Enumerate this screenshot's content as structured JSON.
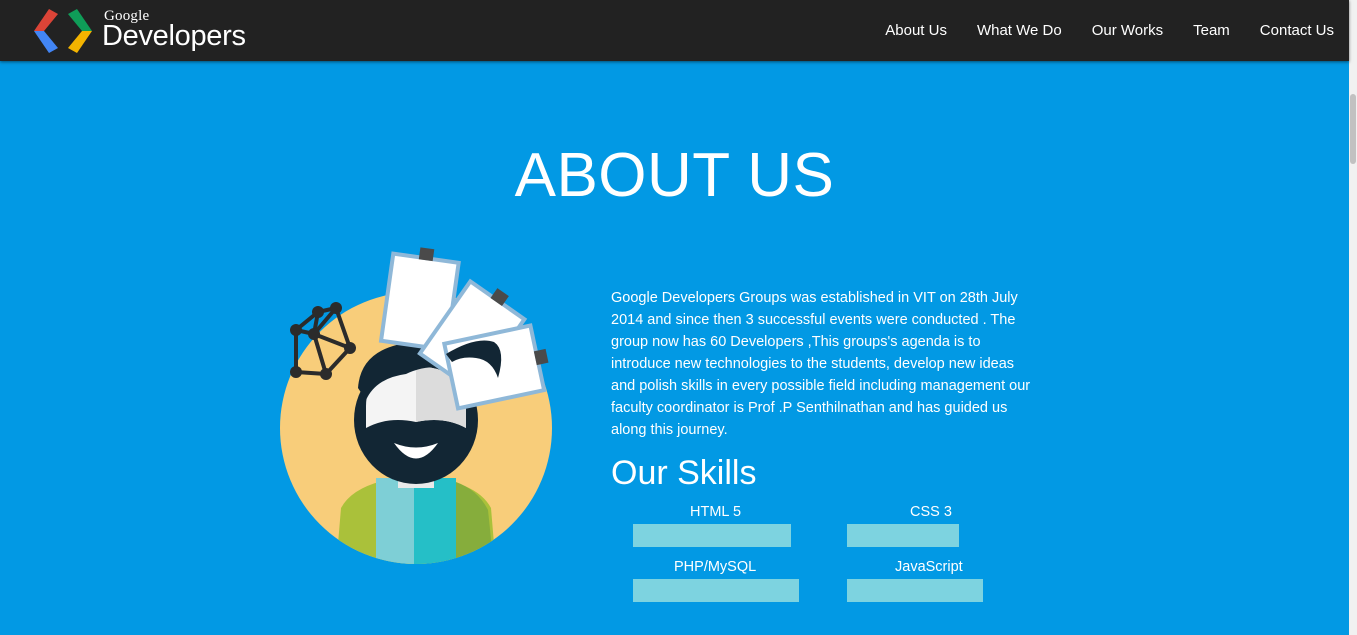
{
  "header": {
    "brand_small": "Google",
    "brand_large": "Developers",
    "nav": [
      "About Us",
      "What We Do",
      "Our Works",
      "Team",
      "Contact Us"
    ]
  },
  "about": {
    "title": "ABOUT US",
    "description": "Google Developers Groups was established in VIT on 28th July 2014 and since then 3 successful events were conducted . The group now has 60 Developers ,This groups's agenda is to introduce new technologies to the students, develop new ideas and polish skills in every possible field including management our faculty coordinator is Prof .P Senthilnathan and has guided us along this journey."
  },
  "skills": {
    "heading": "Our Skills",
    "items": [
      {
        "name": "HTML 5",
        "level": 0.75
      },
      {
        "name": "CSS 3",
        "level": 0.55
      },
      {
        "name": "PHP/MySQL",
        "level": 0.8
      },
      {
        "name": "JavaScript",
        "level": 0.68
      }
    ]
  },
  "colors": {
    "background": "#0299e4",
    "navbar": "#222222",
    "skill_bar": "#7dd3e0",
    "text": "#ffffff"
  }
}
